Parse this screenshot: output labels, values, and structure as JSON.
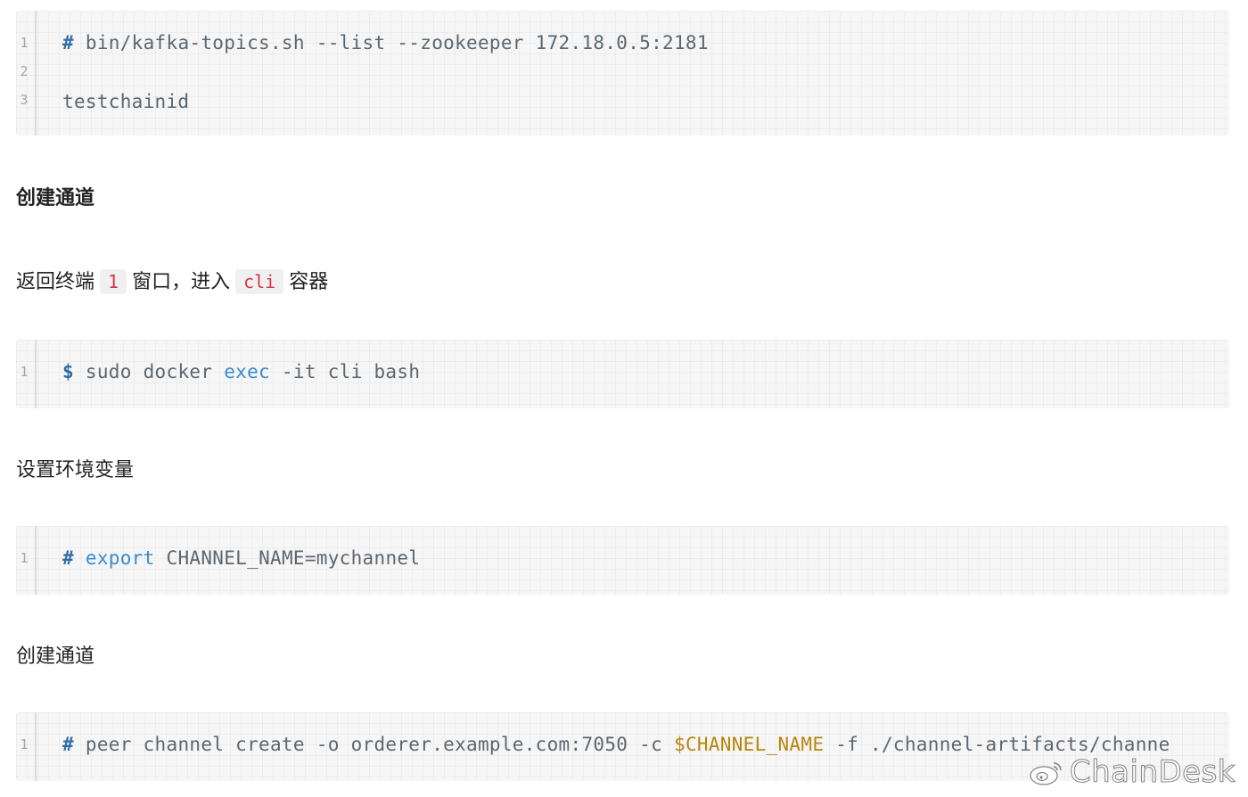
{
  "blocks": {
    "topics_list": {
      "line_numbers": [
        "1",
        "2",
        "3"
      ],
      "line1": {
        "prompt": "#",
        "rest": " bin/kafka-topics.sh --list --zookeeper 172.18.0.5:2181"
      },
      "line3": "testchainid"
    },
    "heading1": "创建通道",
    "para_return": {
      "before": "返回终端",
      "code1": "1",
      "middle": "窗口，进入",
      "code2": "cli",
      "after": "容器"
    },
    "docker_exec": {
      "line_numbers": [
        "1"
      ],
      "prompt": "$",
      "part1": " sudo docker ",
      "keyword": "exec",
      "part2": " -it cli bash"
    },
    "heading_env": "设置环境变量",
    "export_block": {
      "line_numbers": [
        "1"
      ],
      "prompt": "#",
      "keyword": "export",
      "rest": " CHANNEL_NAME=mychannel"
    },
    "heading2": "创建通道",
    "create_block": {
      "line_numbers": [
        "1"
      ],
      "prompt": "#",
      "part1": " peer channel create -o orderer.example.com:7050 -c ",
      "variable": "$CHANNEL_NAME",
      "part2": " -f ./channel-artifacts/channe"
    }
  },
  "watermark": {
    "text": "ChainDesk",
    "icon": "weibo-logo-icon"
  },
  "colors": {
    "hash_prompt": "#2f6ea6",
    "keyword": "#3a8ccf",
    "variable": "#b8860b",
    "inline_code": "#d13a4a",
    "code_text": "#5b6770"
  }
}
